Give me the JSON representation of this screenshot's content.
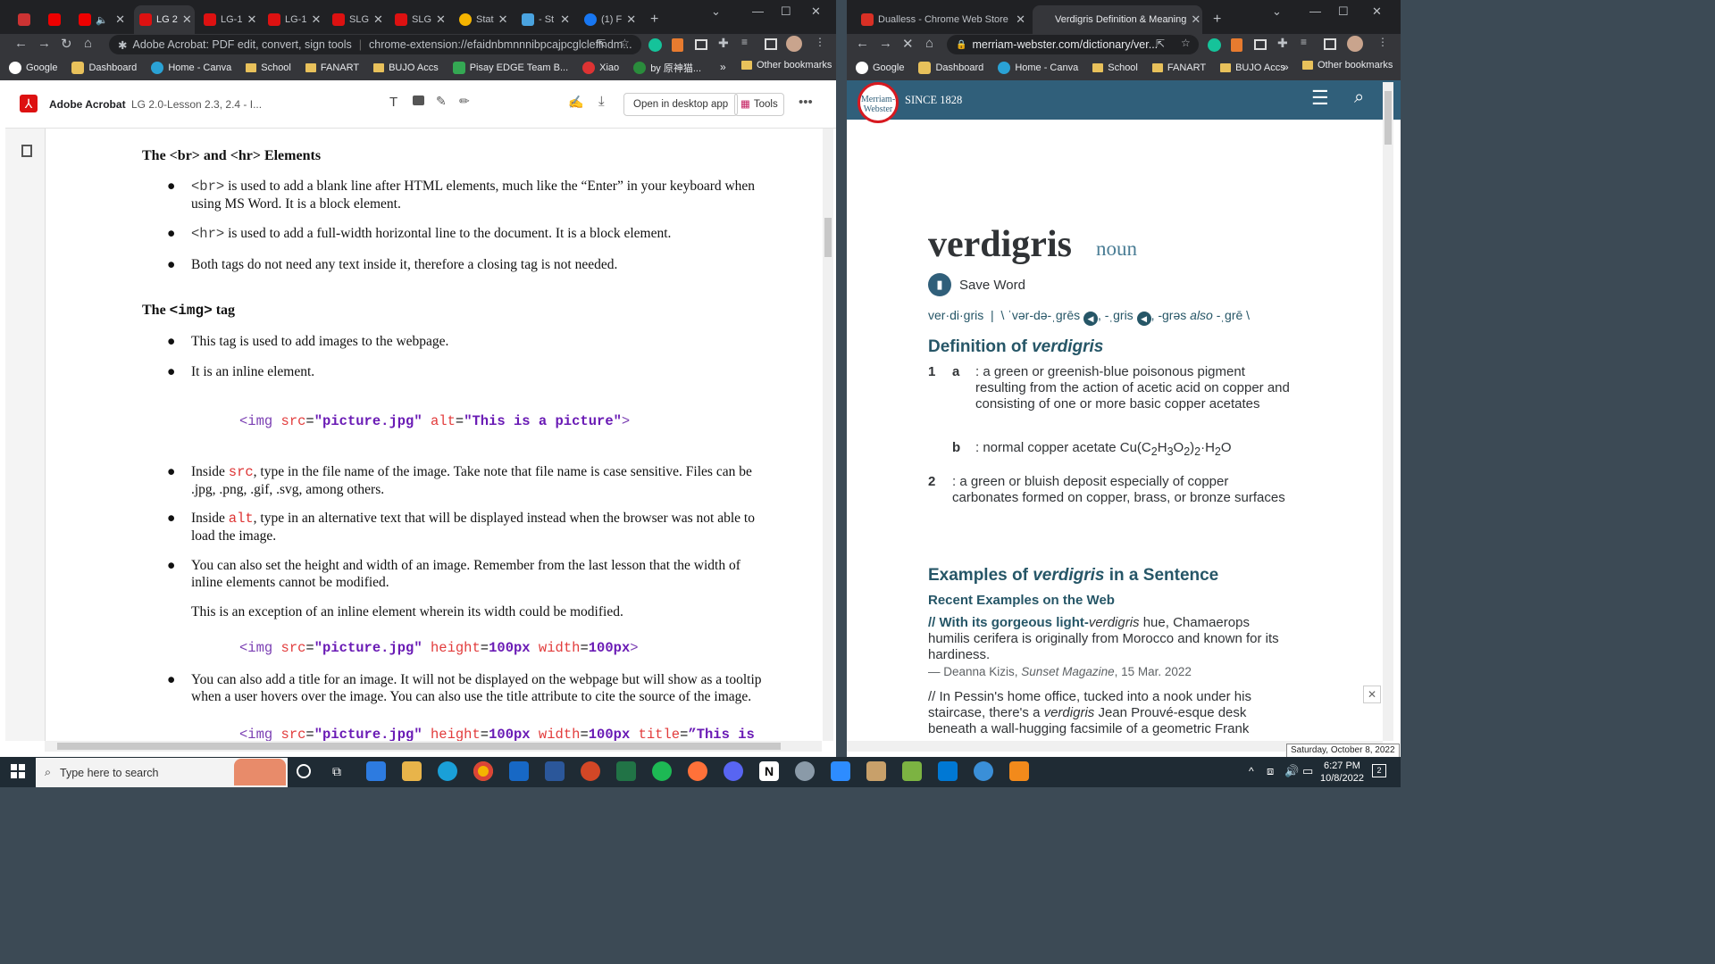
{
  "left_window": {
    "tabs": [
      {
        "title": ""
      },
      {
        "title": ""
      },
      {
        "title": ""
      },
      {
        "title": "LG 2"
      },
      {
        "title": "LG-1"
      },
      {
        "title": "LG-1"
      },
      {
        "title": "SLG"
      },
      {
        "title": "SLG"
      },
      {
        "title": "Stat"
      },
      {
        "title": "- St"
      },
      {
        "title": "(1) F"
      }
    ],
    "address": {
      "site": "Adobe Acrobat: PDF edit, convert, sign tools",
      "url": "chrome-extension://efaidnbmnnnibpcajpcglclefindm..."
    },
    "bookmarks": [
      "Google",
      "Dashboard",
      "Home - Canva",
      "School",
      "FANART",
      "BUJO Accs",
      "Pisay EDGE Team B...",
      "Xiao",
      "by 原神猫..."
    ],
    "other_bookmarks": "Other bookmarks",
    "acrobat": {
      "app": "Adobe Acrobat",
      "doc": "LG 2.0-Lesson 2.3, 2.4 - I...",
      "open_desktop": "Open in desktop app",
      "tools": "Tools"
    },
    "doc": {
      "h1": "The <br> and <hr> Elements",
      "b1a": "<br>",
      "b1b": " is used to add a blank line after HTML elements, much like the “Enter” in your keyboard when using MS Word. It is a block element.",
      "b2a": "<hr>",
      "b2b": " is used to add a full-width horizontal line to the document. It is a block element.",
      "b3": "Both tags do not need any text inside it, therefore a closing tag is not needed.",
      "h2a": "The ",
      "h2b": "<img>",
      "h2c": " tag",
      "b4": "This tag is used to add images to the webpage.",
      "b5": "It is an inline element.",
      "c1": [
        "<img ",
        "src",
        "=",
        "\"picture.jpg\"",
        " ",
        "alt",
        "=",
        "\"This is a picture\"",
        ">"
      ],
      "b6a": "Inside ",
      "b6b": "src",
      "b6c": ", type in the file name of the image. Take note that file name is case sensitive. Files can be .jpg, .png, .gif, .svg, among others.",
      "b7a": "Inside ",
      "b7b": "alt",
      "b7c": ", type in an alternative text that will be displayed instead when the browser was not able to load the image.",
      "b8": "You can also set the height and width of an image. Remember from the last lesson that the width of inline elements cannot be modified.",
      "p1": "This is an exception of an inline element wherein its  width could be modified.",
      "c2": [
        "<img ",
        "src",
        "=",
        "\"picture.jpg\"",
        " ",
        "height",
        "=",
        "100px",
        " ",
        "width",
        "=",
        "100px",
        ">"
      ],
      "b9": "You can also add a title for an image. It will not be displayed on the webpage but will show as a tooltip when a user hovers over the image. You can also use the title attribute to cite the source of the image.",
      "c3": [
        "<img ",
        "src",
        "=",
        "\"picture.jpg\"",
        " ",
        "height",
        "=",
        "100px",
        " ",
        "width",
        "=",
        "100px",
        " ",
        "title",
        "=",
        "”This is"
      ]
    }
  },
  "right_window": {
    "tabs": [
      {
        "title": "Dualless - Chrome Web Store"
      },
      {
        "title": "Verdigris Definition & Meaning"
      }
    ],
    "address": {
      "url": "merriam-webster.com/dictionary/ver..."
    },
    "bookmarks": [
      "Google",
      "Dashboard",
      "Home - Canva",
      "School",
      "FANART",
      "BUJO Accs"
    ],
    "other_bookmarks": "Other bookmarks",
    "mw": {
      "logo_top": "Merriam-",
      "logo_bottom": "Webster",
      "since": "SINCE 1828",
      "word": "verdigris",
      "pos": "noun",
      "save": "Save Word",
      "syll": "ver·di·gris",
      "sep": "|",
      "pron": "\\ ˈvər-də-ˌgrēs",
      "pron2": ", -ˌgris",
      "pron3": ", -grəs ",
      "also": "also",
      " pron4": "",
      "pron4": " -ˌgrē \\",
      "def_head_a": "Definition of ",
      "def_head_b": "verdigris",
      "d1": "1",
      "d1a": "a",
      "d1a_text": ": a green or greenish-blue poisonous pigment resulting from the action of acetic acid on copper and consisting of one or more basic copper acetates",
      "d1b": "b",
      "d1b_text": ": normal copper acetate Cu(C",
      "d1b_sub1": "2",
      "d1b_mid": "H",
      "d1b_sub2": "3",
      "d1b_mid2": "O",
      "d1b_sub3": "2",
      "d1b_mid3": ")",
      "d1b_sub4": "2",
      "d1b_end": "·H",
      "d1b_sub5": "2",
      "d1b_end2": "O",
      "d2": "2",
      "d2_text": ": a green or bluish deposit especially of copper carbonates formed on copper, brass, or bronze surfaces",
      "ex_head_a": "Examples of ",
      "ex_head_b": "verdigris",
      "ex_head_c": " in a Sentence",
      "recent": "Recent Examples on the Web",
      "ex1a": "// With its gorgeous light-",
      "ex1b": "verdigris",
      "ex1c": " hue, Chamaerops humilis cerifera is originally from Morocco and known for its hardiness.",
      "src1a": "— Deanna Kizis, ",
      "src1b": "Sunset Magazine",
      "src1c": ", 15 Mar. 2022",
      "ex2a": "// In Pessin's home office, tucked into a nook under his staircase, there's a ",
      "ex2b": "verdigris",
      "ex2c": " Jean Prouvé-esque desk beneath a wall-hugging facsimile of a geometric Frank"
    },
    "tooltip": "Saturday, October 8, 2022"
  },
  "taskbar": {
    "search": "Type here to search",
    "time": "6:27 PM",
    "date": "10/8/2022",
    "notif": "2"
  }
}
